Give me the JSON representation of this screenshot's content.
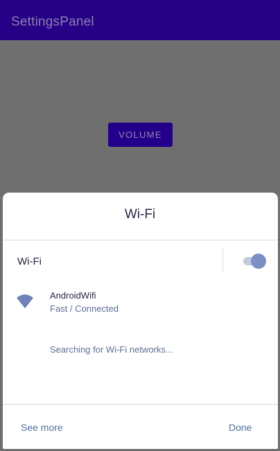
{
  "app_bar": {
    "title": "SettingsPanel"
  },
  "main": {
    "volume_button_label": "VOLUME"
  },
  "panel": {
    "title": "Wi-Fi",
    "wifi_toggle": {
      "label": "Wi-Fi",
      "checked": true
    },
    "networks": [
      {
        "name": "AndroidWifi",
        "status": "Fast / Connected",
        "icon": "wifi-icon"
      }
    ],
    "searching_text": "Searching for Wi-Fi networks...",
    "see_more_label": "See more",
    "done_label": "Done"
  },
  "colors": {
    "app_bar": "#260085",
    "scrim": "#6f6f6f",
    "accent": "#7d8ec4",
    "link": "#536d9a"
  }
}
